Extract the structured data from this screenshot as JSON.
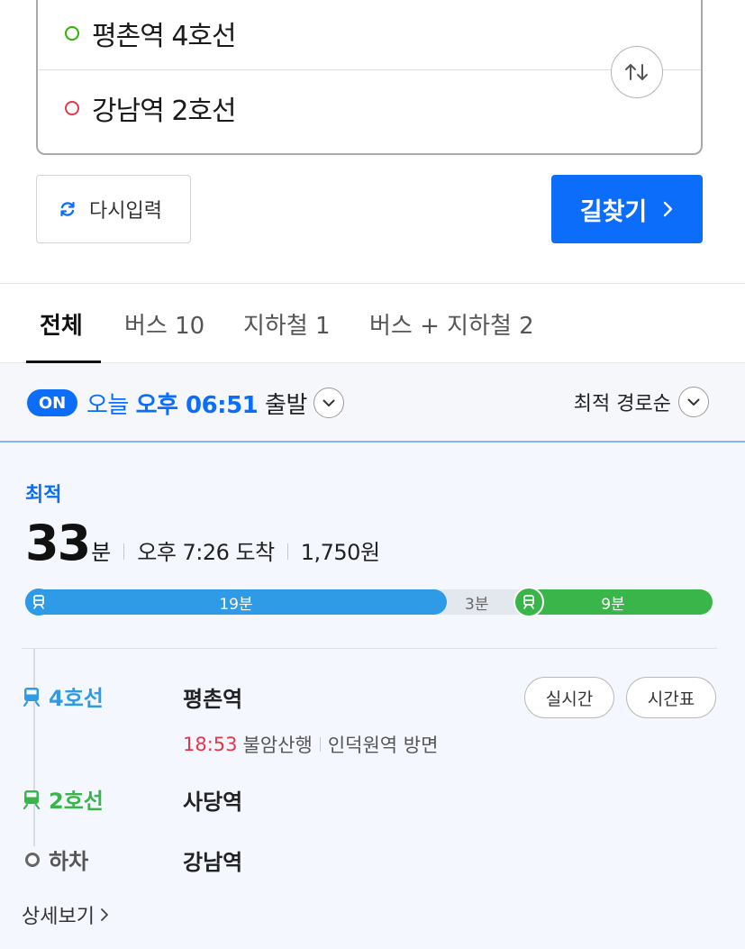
{
  "search": {
    "start": "평촌역 4호선",
    "end": "강남역 2호선",
    "reset_label": "다시입력",
    "go_label": "길찾기"
  },
  "tabs": [
    {
      "label": "전체",
      "active": true
    },
    {
      "label": "버스 10"
    },
    {
      "label": "지하철 1"
    },
    {
      "label": "버스 + 지하철 2"
    }
  ],
  "timebar": {
    "badge": "ON",
    "day": "오늘",
    "time": "오후 06:51",
    "suffix": "출발",
    "sort_label": "최적 경로순"
  },
  "route": {
    "tag": "최적",
    "minutes": "33",
    "minutes_unit": "분",
    "arrival": "오후 7:26 도착",
    "fare": "1,750원",
    "segments": [
      {
        "label": "19분",
        "color": "#2f9be6"
      },
      {
        "label": "3분"
      },
      {
        "label": "9분",
        "color": "#3ab54a"
      }
    ],
    "steps": [
      {
        "line": "4호선",
        "station": "평촌역",
        "color": "#2f9be6"
      },
      {
        "line": "2호선",
        "station": "사당역",
        "color": "#3ab54a"
      },
      {
        "line": "하차",
        "station": "강남역"
      }
    ],
    "departure": {
      "time": "18:53",
      "destination": "불암산행",
      "direction": "인덕원역 방면"
    },
    "realtime_label": "실시간",
    "timetable_label": "시간표",
    "detail_label": "상세보기"
  },
  "colors": {
    "accent": "#0c6dfa",
    "line4": "#2f9be6",
    "line2": "#3ab54a",
    "time_red": "#e8354b"
  }
}
